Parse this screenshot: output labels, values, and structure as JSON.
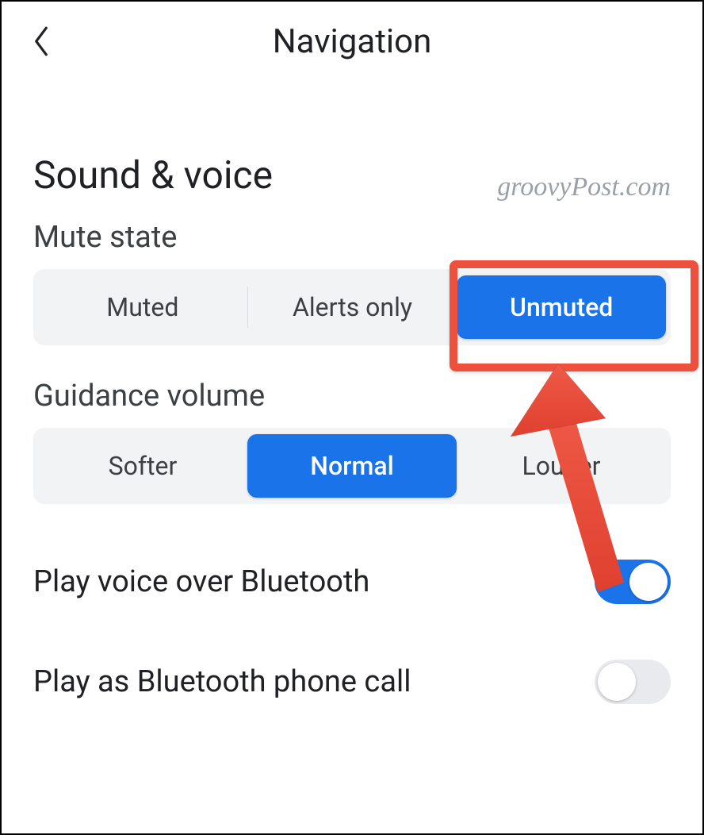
{
  "header": {
    "title": "Navigation"
  },
  "watermark": "groovyPost.com",
  "section": {
    "title": "Sound & voice",
    "mute_state": {
      "label": "Mute state",
      "options": [
        "Muted",
        "Alerts only",
        "Unmuted"
      ],
      "selected": "Unmuted"
    },
    "guidance_volume": {
      "label": "Guidance volume",
      "options": [
        "Softer",
        "Normal",
        "Louder"
      ],
      "selected": "Normal"
    },
    "toggles": {
      "bluetooth_voice": {
        "label": "Play voice over Bluetooth",
        "value": true
      },
      "bluetooth_phone": {
        "label": "Play as Bluetooth phone call",
        "value": false
      }
    }
  },
  "colors": {
    "accent": "#1a73e8",
    "annotation": "#ee503e",
    "segment_bg": "#f1f3f4"
  }
}
